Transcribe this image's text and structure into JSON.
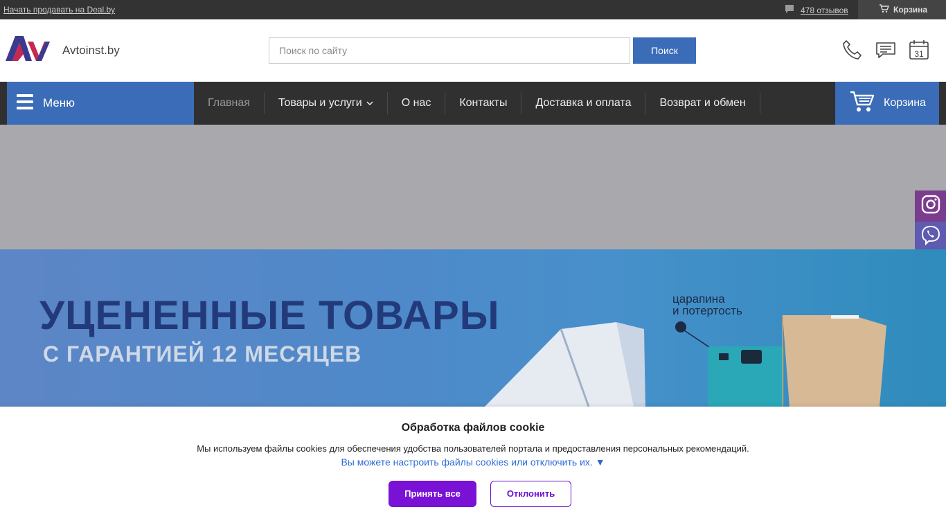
{
  "topbar": {
    "sell_link": "Начать продавать на Deal.by",
    "reviews_link": "478 отзывов",
    "cart_label": "Корзина"
  },
  "header": {
    "site_name": "Avtoinst.by",
    "search_placeholder": "Поиск по сайту",
    "search_button": "Поиск",
    "calendar_day": "31"
  },
  "nav": {
    "menu_label": "Меню",
    "items": [
      {
        "label": "Главная"
      },
      {
        "label": "Товары и услуги"
      },
      {
        "label": "О нас"
      },
      {
        "label": "Контакты"
      },
      {
        "label": "Доставка и оплата"
      },
      {
        "label": "Возврат и обмен"
      }
    ],
    "cart_label": "Корзина"
  },
  "banner": {
    "title": "УЦЕНЕННЫЕ ТОВАРЫ",
    "subtitle": "С ГАРАНТИЕЙ 12 МЕСЯЦЕВ",
    "note_line1": "царапина",
    "note_line2": "и потертость"
  },
  "cookie": {
    "title": "Обработка файлов cookie",
    "text": "Мы используем файлы cookies для обеспечения удобства пользователей портала и предоставления персональных рекомендаций.",
    "settings_link": "Вы можете настроить файлы cookies или отключить их.",
    "accept_button": "Принять все",
    "decline_button": "Отклонить"
  },
  "colors": {
    "accent_blue": "#3b6cb7",
    "cookie_purple": "#7a12d6",
    "nav_bg": "#303030"
  }
}
